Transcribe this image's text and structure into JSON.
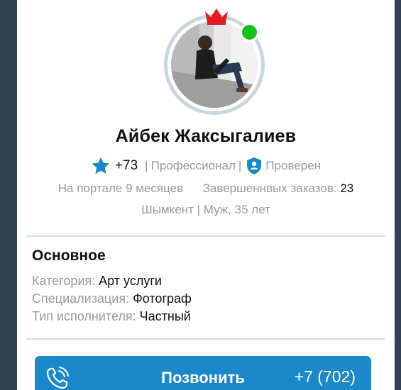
{
  "profile": {
    "name": "Айбек Жаксыгалиев",
    "rating": "+73",
    "level": "Профессионал",
    "verified": "Проверен",
    "on_portal": "На портале 9 месяцев",
    "completed_label": "Завершеннвых заказов:",
    "completed_count": "23",
    "location": "Шымкент | Муж, 35 лет",
    "online": true
  },
  "basics": {
    "title": "Основное",
    "rows": [
      {
        "label": "Категория:",
        "value": "Арт услуги"
      },
      {
        "label": "Специализация:",
        "value": "Фотограф"
      },
      {
        "label": "Тип исполнителя:",
        "value": "Частный"
      }
    ]
  },
  "call": {
    "label": "Позвонить",
    "number": "+7 (702)"
  },
  "icons": {
    "crown": "crown-icon",
    "star": "star-icon",
    "shield": "shield-user-icon",
    "phone": "phone-ringing-icon"
  },
  "colors": {
    "background": "#30404e",
    "accent_blue": "#1b88c9",
    "crown_red": "#e11b22",
    "online_green": "#17c21b",
    "muted_text": "#9b9b9b"
  }
}
